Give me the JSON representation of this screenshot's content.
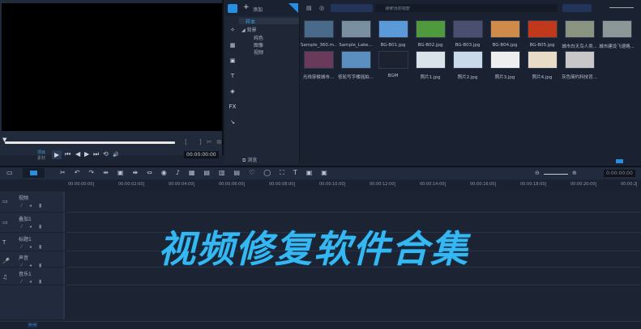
{
  "preview": {
    "play_mode": [
      "项目",
      "素材"
    ],
    "timecode": "00:00:00:00",
    "controls": [
      "▶",
      "⏮",
      "◀",
      "▶",
      "⏭",
      "⟲",
      "🔊"
    ]
  },
  "library": {
    "add_label": "添加",
    "search_placeholder": "搜索当前视图",
    "browse_label": "浏览",
    "tree": {
      "samples": "样本",
      "background": "背景",
      "solid": "纯色",
      "image": "图像",
      "video": "视频"
    },
    "side_icons": [
      "media",
      "instant",
      "transition",
      "title",
      "graphic",
      "FX",
      "path"
    ],
    "items": [
      {
        "label": "Sample_360.m...",
        "color": "#4a6a8a"
      },
      {
        "label": "Sample_Lake...",
        "color": "#7a8fa0"
      },
      {
        "label": "BG-B01.jpg",
        "color": "#5a9ad8"
      },
      {
        "label": "BG-B02.jpg",
        "color": "#4f9a3f"
      },
      {
        "label": "BG-B03.jpg",
        "color": "#4a4f70"
      },
      {
        "label": "BG-B04.jpg",
        "color": "#d08a4a"
      },
      {
        "label": "BG-B05.jpg",
        "color": "#c0391a"
      },
      {
        "label": "城市白天鸟人类...",
        "color": "#8a9480"
      },
      {
        "label": "城市建设飞速略...",
        "color": "#8c9898"
      },
      {
        "label": "光线穿梭城市...",
        "color": "#6a3a5a"
      },
      {
        "label": "低轮写字楼摇拍...",
        "color": "#5a8fc0"
      },
      {
        "label": "BGM",
        "color": "#1c2230"
      },
      {
        "label": "照片1.jpg",
        "color": "#d8e4ea"
      },
      {
        "label": "照片2.jpg",
        "color": "#c9daea"
      },
      {
        "label": "照片3.jpg",
        "color": "#eeeeee"
      },
      {
        "label": "照片4.jpg",
        "color": "#e8dcc8"
      },
      {
        "label": "灰色简约科技背...",
        "color": "#c8c8c8"
      }
    ]
  },
  "timeline": {
    "timecode": "0:00:00:00",
    "ruler": [
      "00:00:00:00",
      "00:00:02:00",
      "00:00:04:00",
      "00:00:06:00",
      "00:00:08:00",
      "00:00:10:00",
      "00:00:12:00",
      "00:00:14:00",
      "00:00:16:00",
      "00:00:18:00",
      "00:00:20:00",
      "00:00:2"
    ],
    "tracks": [
      {
        "name": "视频",
        "icon": "▭"
      },
      {
        "name": "叠加1",
        "icon": "▭"
      },
      {
        "name": "标题1",
        "icon": "T"
      },
      {
        "name": "声音",
        "icon": "🎤"
      },
      {
        "name": "音乐1",
        "icon": "♫"
      }
    ]
  },
  "overlay_text": "视频修复软件合集",
  "accent": "#35b8f2"
}
